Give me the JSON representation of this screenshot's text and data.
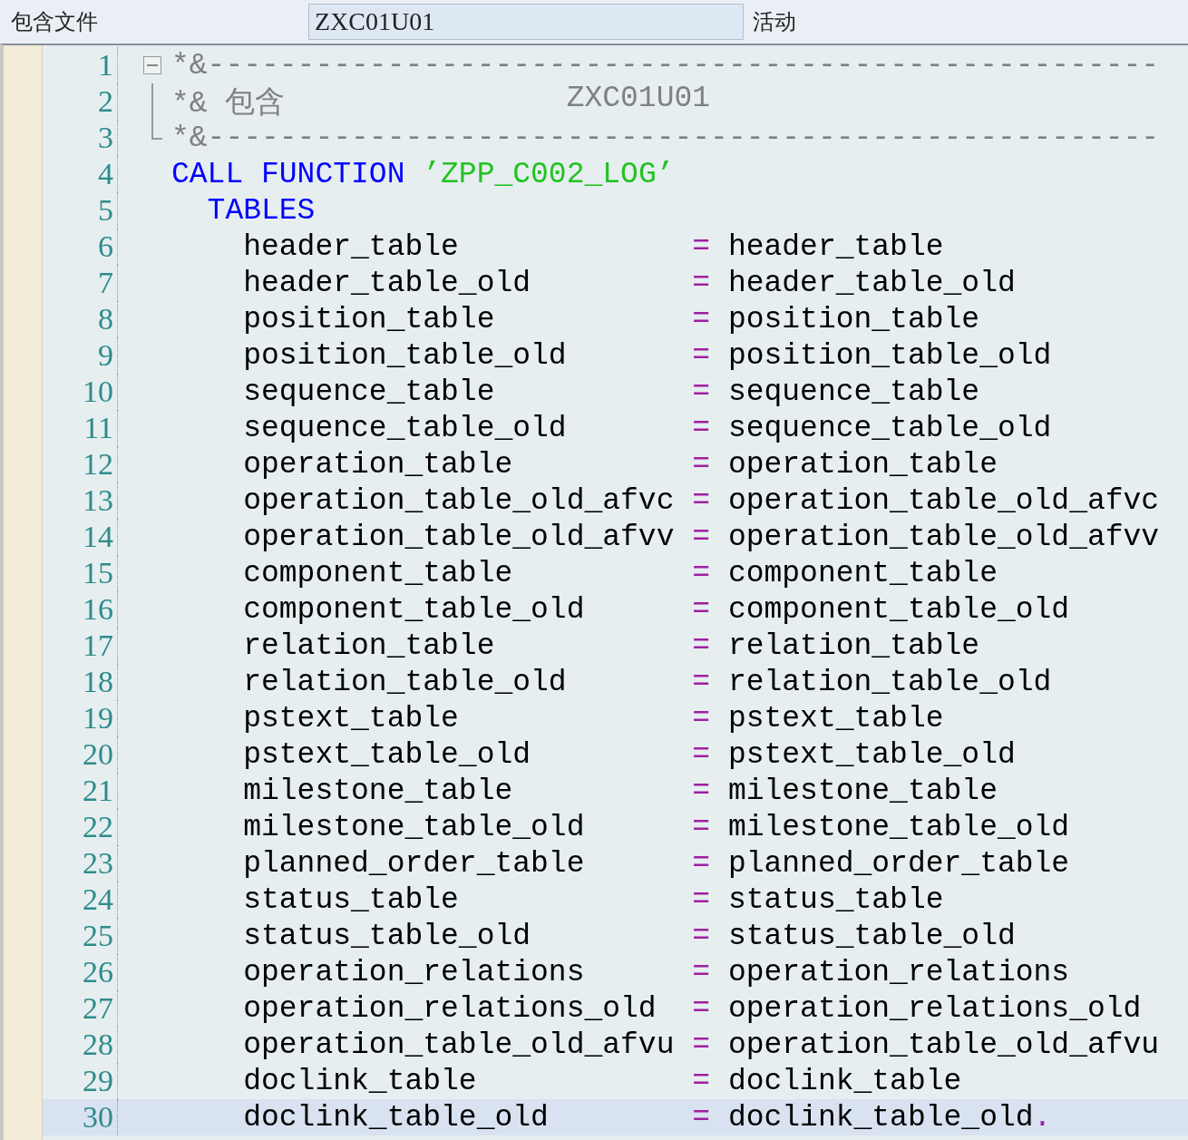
{
  "header": {
    "label": "包含文件",
    "include_name": "ZXC01U01",
    "status": "活动"
  },
  "fold": {
    "expanded": true
  },
  "lines": [
    {
      "number": "1",
      "kind": "comment",
      "selected": false,
      "parts": [
        "*&-----------------------------------------------------"
      ]
    },
    {
      "number": "2",
      "kind": "comment",
      "selected": false,
      "parts": [
        "*& 包含",
        "ZXC01U01"
      ]
    },
    {
      "number": "3",
      "kind": "comment",
      "selected": false,
      "parts": [
        "*&-----------------------------------------------------"
      ]
    },
    {
      "number": "4",
      "kind": "call",
      "selected": false,
      "keyword": "CALL FUNCTION",
      "string": "’ZPP_C002_LOG’"
    },
    {
      "number": "5",
      "kind": "tables",
      "selected": false,
      "keyword": "TABLES"
    },
    {
      "number": "6",
      "kind": "param",
      "selected": false,
      "formal": "header_table",
      "operator": "=",
      "actual": "header_table"
    },
    {
      "number": "7",
      "kind": "param",
      "selected": false,
      "formal": "header_table_old",
      "operator": "=",
      "actual": "header_table_old"
    },
    {
      "number": "8",
      "kind": "param",
      "selected": false,
      "formal": "position_table",
      "operator": "=",
      "actual": "position_table"
    },
    {
      "number": "9",
      "kind": "param",
      "selected": false,
      "formal": "position_table_old",
      "operator": "=",
      "actual": "position_table_old"
    },
    {
      "number": "10",
      "kind": "param",
      "selected": false,
      "formal": "sequence_table",
      "operator": "=",
      "actual": "sequence_table"
    },
    {
      "number": "11",
      "kind": "param",
      "selected": false,
      "formal": "sequence_table_old",
      "operator": "=",
      "actual": "sequence_table_old"
    },
    {
      "number": "12",
      "kind": "param",
      "selected": false,
      "formal": "operation_table",
      "operator": "=",
      "actual": "operation_table"
    },
    {
      "number": "13",
      "kind": "param",
      "selected": false,
      "formal": "operation_table_old_afvc",
      "operator": "=",
      "actual": "operation_table_old_afvc"
    },
    {
      "number": "14",
      "kind": "param",
      "selected": false,
      "formal": "operation_table_old_afvv",
      "operator": "=",
      "actual": "operation_table_old_afvv"
    },
    {
      "number": "15",
      "kind": "param",
      "selected": false,
      "formal": "component_table",
      "operator": "=",
      "actual": "component_table"
    },
    {
      "number": "16",
      "kind": "param",
      "selected": false,
      "formal": "component_table_old",
      "operator": "=",
      "actual": "component_table_old"
    },
    {
      "number": "17",
      "kind": "param",
      "selected": false,
      "formal": "relation_table",
      "operator": "=",
      "actual": "relation_table"
    },
    {
      "number": "18",
      "kind": "param",
      "selected": false,
      "formal": "relation_table_old",
      "operator": "=",
      "actual": "relation_table_old"
    },
    {
      "number": "19",
      "kind": "param",
      "selected": false,
      "formal": "pstext_table",
      "operator": "=",
      "actual": "pstext_table"
    },
    {
      "number": "20",
      "kind": "param",
      "selected": false,
      "formal": "pstext_table_old",
      "operator": "=",
      "actual": "pstext_table_old"
    },
    {
      "number": "21",
      "kind": "param",
      "selected": false,
      "formal": "milestone_table",
      "operator": "=",
      "actual": "milestone_table"
    },
    {
      "number": "22",
      "kind": "param",
      "selected": false,
      "formal": "milestone_table_old",
      "operator": "=",
      "actual": "milestone_table_old"
    },
    {
      "number": "23",
      "kind": "param",
      "selected": false,
      "formal": "planned_order_table",
      "operator": "=",
      "actual": "planned_order_table"
    },
    {
      "number": "24",
      "kind": "param",
      "selected": false,
      "formal": "status_table",
      "operator": "=",
      "actual": "status_table"
    },
    {
      "number": "25",
      "kind": "param",
      "selected": false,
      "formal": "status_table_old",
      "operator": "=",
      "actual": "status_table_old"
    },
    {
      "number": "26",
      "kind": "param",
      "selected": false,
      "formal": "operation_relations",
      "operator": "=",
      "actual": "operation_relations"
    },
    {
      "number": "27",
      "kind": "param",
      "selected": false,
      "formal": "operation_relations_old",
      "operator": "=",
      "actual": "operation_relations_old"
    },
    {
      "number": "28",
      "kind": "param",
      "selected": false,
      "formal": "operation_table_old_afvu",
      "operator": "=",
      "actual": "operation_table_old_afvu"
    },
    {
      "number": "29",
      "kind": "param",
      "selected": false,
      "formal": "doclink_table",
      "operator": "=",
      "actual": "doclink_table"
    },
    {
      "number": "30",
      "kind": "param",
      "selected": true,
      "formal": "doclink_table_old",
      "operator": "=",
      "actual": "doclink_table_old",
      "terminator": "."
    }
  ]
}
